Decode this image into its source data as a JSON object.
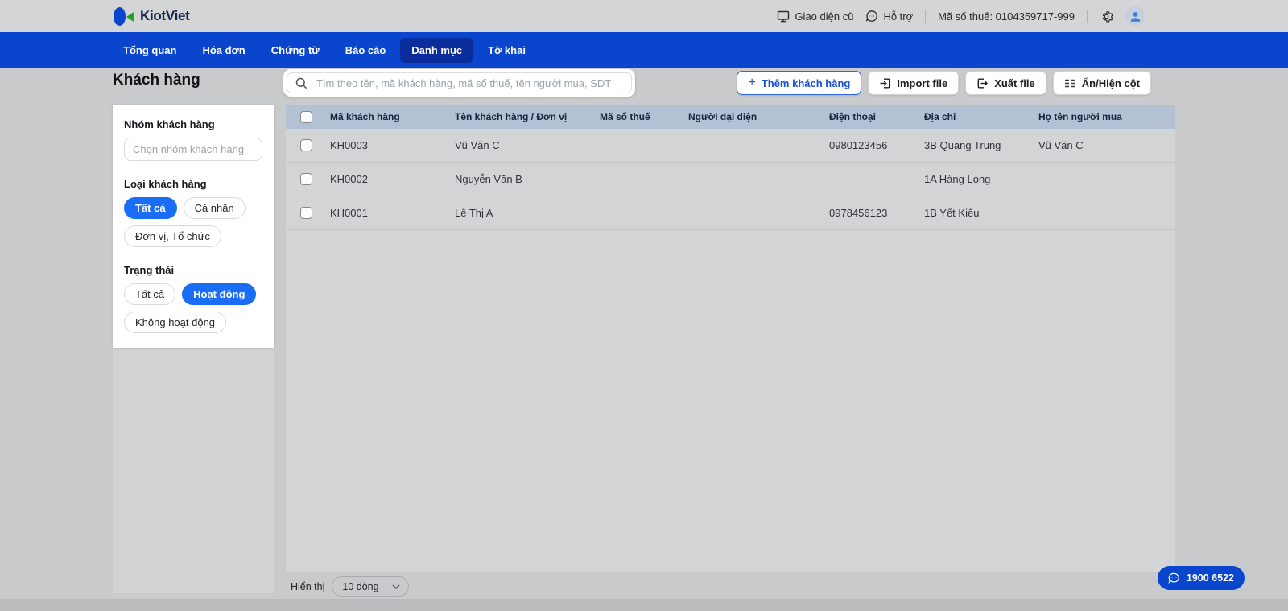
{
  "colors": {
    "nav_bar": "#0946cd",
    "nav_active": "#0b2d9b",
    "pill_active": "#1a6ef5",
    "accent_blue": "#1b50d9",
    "table_header_bg": "#b4c1d5",
    "brand_green": "#23a127"
  },
  "topbar": {
    "brand": "KiotViet",
    "old_ui_label": "Giao diện cũ",
    "support_label": "Hỗ trợ",
    "tax_code": "Mã số thuế: 0104359717-999"
  },
  "nav": {
    "items": [
      {
        "label": "Tổng quan",
        "active": false
      },
      {
        "label": "Hóa đơn",
        "active": false
      },
      {
        "label": "Chứng từ",
        "active": false
      },
      {
        "label": "Báo cáo",
        "active": false
      },
      {
        "label": "Danh mục",
        "active": true
      },
      {
        "label": "Tờ khai",
        "active": false
      }
    ]
  },
  "page": {
    "title": "Khách hàng",
    "search_placeholder": "Tìm theo tên, mã khách hàng, mã số thuế, tên người mua, SDT"
  },
  "actions": {
    "add_label": "Thêm khách hàng",
    "import_label": "Import file",
    "export_label": "Xuất file",
    "columns_label": "Ẩn/Hiện cột"
  },
  "filters": {
    "group_label": "Nhóm khách hàng",
    "group_placeholder": "Chọn nhóm khách hàng",
    "type_label": "Loại khách hàng",
    "type_options": [
      {
        "label": "Tất cả",
        "active": true
      },
      {
        "label": "Cá nhân",
        "active": false
      },
      {
        "label": "Đơn vị, Tổ chức",
        "active": false
      }
    ],
    "status_label": "Trạng thái",
    "status_options": [
      {
        "label": "Tất cả",
        "active": false
      },
      {
        "label": "Hoạt động",
        "active": true
      },
      {
        "label": "Không hoạt động",
        "active": false
      }
    ]
  },
  "table": {
    "columns": [
      "Mã khách hàng",
      "Tên khách hàng / Đơn vị",
      "Mã số thuế",
      "Người đại diện",
      "Điện thoại",
      "Địa chỉ",
      "Họ tên người mua"
    ],
    "rows": [
      {
        "code": "KH0003",
        "name": "Vũ Văn C",
        "tax": "",
        "rep": "",
        "phone": "0980123456",
        "address": "3B Quang Trung",
        "buyer": "Vũ Văn C"
      },
      {
        "code": "KH0002",
        "name": "Nguyễn Văn B",
        "tax": "",
        "rep": "",
        "phone": "",
        "address": "1A Hàng Lọng",
        "buyer": ""
      },
      {
        "code": "KH0001",
        "name": "Lê Thị A",
        "tax": "",
        "rep": "",
        "phone": "0978456123",
        "address": "1B Yết Kiêu",
        "buyer": ""
      }
    ]
  },
  "footer": {
    "show_label": "Hiển thị",
    "rows_per_page": "10 dòng"
  },
  "hotline": {
    "label": "1900 6522"
  }
}
